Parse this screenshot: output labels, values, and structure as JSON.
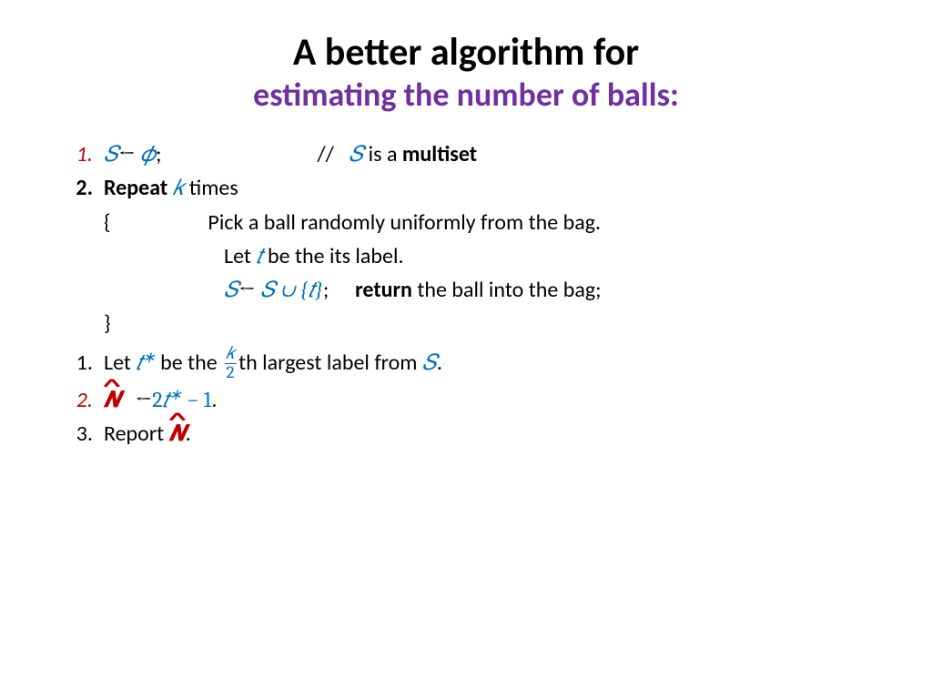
{
  "title": {
    "line1": "A better algorithm for",
    "line2": "estimating the number of balls:"
  },
  "steps": {
    "s1": {
      "num": "1.",
      "S": "𝑆",
      "arrow": "←",
      "phi": "𝜙",
      "semi": ";",
      "slashes": "//",
      "S2": "𝑆",
      "is_a": " is a ",
      "multiset": "multiset"
    },
    "s2": {
      "num": "2.",
      "repeat": "Repeat ",
      "k": "𝑘",
      "times": " times",
      "lbrace": "{",
      "pick": "Pick a ball randomly uniformly from the bag.",
      "let": "Let ",
      "t": "𝑡",
      "be_label": " be the its label.",
      "S": "𝑆",
      "arrow": "←",
      "union_expr": "𝑆 ∪ {𝑡}",
      "semi": ";",
      "return": "return",
      "return_rest": " the ball into the bag;",
      "rbrace": "}"
    },
    "s3": {
      "num": "1.",
      "let": "Let ",
      "t": "𝑡",
      "star": "∗",
      "be_the": " be the ",
      "k": "𝑘",
      "two": "2",
      "th_largest": "th largest label from ",
      "S": "𝑆",
      "dot": "."
    },
    "s4": {
      "num": "2.",
      "N": "𝑵",
      "arrow": "←",
      "two": "2",
      "t": "𝑡",
      "star": "∗",
      "minus1": " − 1",
      "dot": "."
    },
    "s5": {
      "num": "3.",
      "report": "Report ",
      "N": "𝑵",
      "dot": "."
    }
  }
}
